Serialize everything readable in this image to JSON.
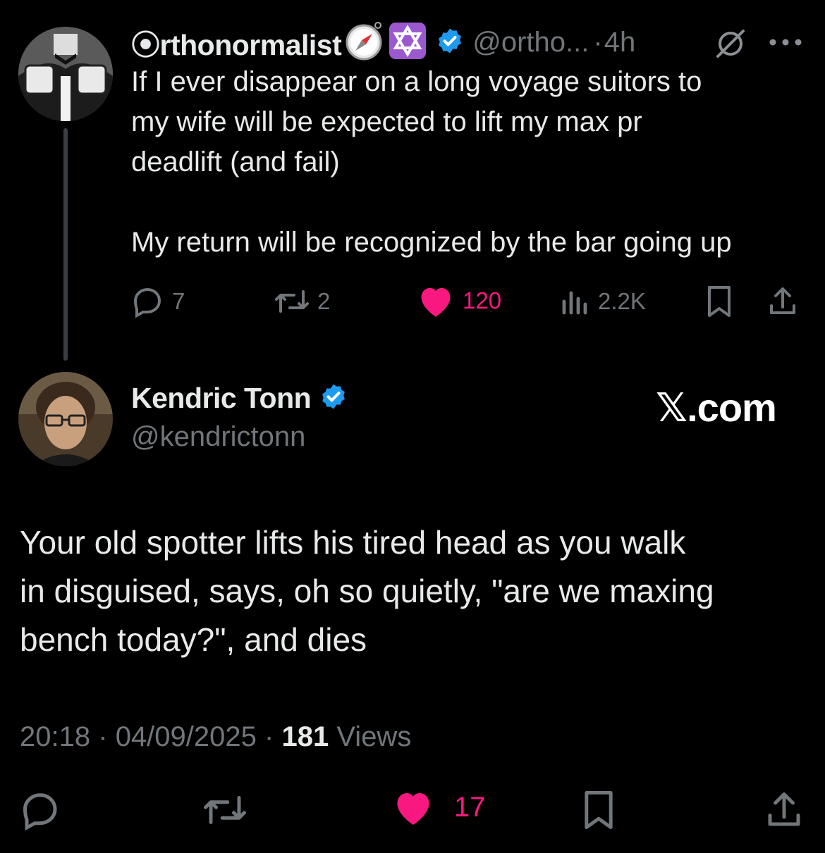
{
  "original": {
    "display_name": "⦿rthonormalist",
    "handle": "@ortho...",
    "separator": "·",
    "time": "4h",
    "text_lines": [
      "If I ever disappear on a long voyage suitors to",
      "my wife will be expected to lift my max pr",
      "deadlift (and fail)",
      "",
      "My return will be recognized by the bar going up"
    ],
    "replies": "7",
    "reposts": "2",
    "likes": "120",
    "views": "2.2K"
  },
  "reply": {
    "display_name": "Kendric Tonn",
    "handle": "@kendrictonn",
    "text_lines": [
      "Your old spotter lifts his tired head as you walk",
      "in disguised, says, oh so quietly, \"are we maxing",
      "bench today?\", and dies"
    ],
    "time": "20:18",
    "sep1": "·",
    "date": "04/09/2025",
    "sep2": "·",
    "views_count": "181",
    "views_label": "Views",
    "likes": "17"
  },
  "watermark": "𝕏.com",
  "colors": {
    "background": "#000000",
    "text": "#e7e9ea",
    "muted": "#71767b",
    "like_pink": "#f91880",
    "verified_blue": "#1d9bf0"
  },
  "icons": [
    "compass-emoji-icon",
    "star-of-david-emoji-icon",
    "verified-badge-icon",
    "grok-icon",
    "more-icon",
    "reply-icon",
    "repost-icon",
    "like-icon",
    "views-icon",
    "bookmark-icon",
    "share-icon"
  ]
}
